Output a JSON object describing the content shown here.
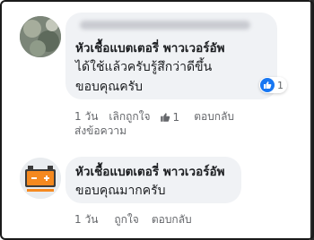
{
  "comments": [
    {
      "author": "",
      "author_redacted": true,
      "mention": "หัวเชื้อแบตเตอรี่ พาวเวอร์อัพ",
      "lines": [
        "ได้ใช้แล้วครับรู้สึกว่าดีขึ้น",
        "ขอบคุณครับ"
      ],
      "reaction_count": "1",
      "time": "1 วัน",
      "unlike_label": "เลิกถูกใจ",
      "like_count": "1",
      "reply_label": "ตอบกลับ",
      "message_label": "ส่งข้อความ"
    },
    {
      "author": "หัวเชื้อแบตเตอรี่ พาวเวอร์อัพ",
      "lines": [
        "ขอบคุณมากครับ"
      ],
      "time": "1 วัน",
      "like_label": "ถูกใจ",
      "reply_label": "ตอบกลับ"
    }
  ],
  "colors": {
    "accent": "#1877f2",
    "bubble": "#f0f2f5",
    "meta": "#65676b",
    "logo_orange": "#f5891f"
  },
  "icons": [
    "like-icon",
    "thumbs-up-icon",
    "battery-logo"
  ]
}
